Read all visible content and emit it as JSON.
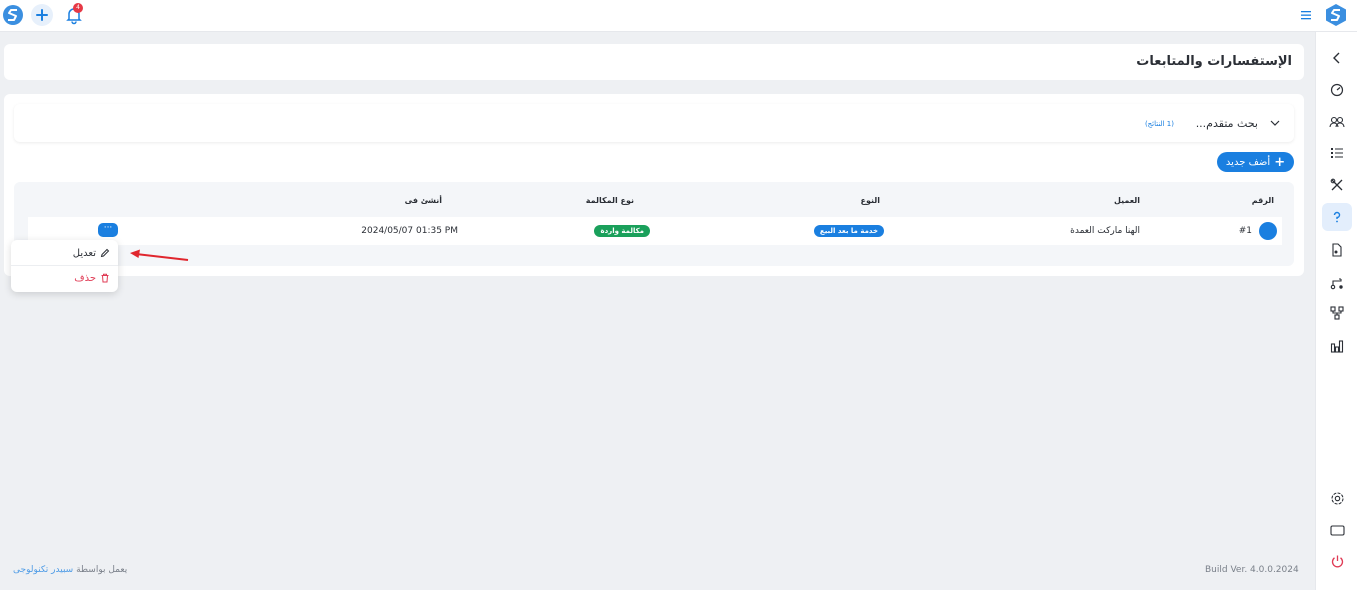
{
  "colors": {
    "accent": "#1a7fe0",
    "success": "#1aa05b",
    "danger": "#e03b55",
    "background": "#eef0f3"
  },
  "topbar": {
    "notification_count": "4",
    "icons": [
      "app-logo-icon",
      "plus-icon",
      "bell-icon",
      "hamburger-menu-icon"
    ]
  },
  "sidebar": {
    "items": [
      {
        "icon": "chevron-left-icon"
      },
      {
        "icon": "dashboard-gauge-icon"
      },
      {
        "icon": "users-icon"
      },
      {
        "icon": "list-icon"
      },
      {
        "icon": "tools-icon"
      },
      {
        "icon": "question-icon",
        "active": true
      },
      {
        "icon": "document-icon"
      },
      {
        "icon": "workflow-icon"
      },
      {
        "icon": "hierarchy-icon"
      },
      {
        "icon": "bar-chart-icon"
      },
      {
        "icon": "settings-icon"
      },
      {
        "icon": "screen-icon"
      },
      {
        "icon": "power-icon"
      }
    ]
  },
  "page": {
    "title": "الإستفسارات والمتابعات"
  },
  "search": {
    "label": "بحث متقدم...",
    "results": "(1 النتائج)"
  },
  "toolbar": {
    "add_label": "أضف جديد"
  },
  "table": {
    "headers": {
      "number": "الرقم",
      "client": "العميل",
      "type": "النوع",
      "call_type": "نوع المكالمة",
      "created_at": "أنشئ فى"
    },
    "rows": [
      {
        "number": "#1",
        "client": "الهنا ماركت العمدة",
        "type": "خدمة ما بعد البيع",
        "call_type": "مكالمة واردة",
        "created_at": "2024/05/07 01:35 PM",
        "actions": "···"
      }
    ]
  },
  "menu": {
    "edit": "تعديل",
    "delete": "حذف"
  },
  "footer": {
    "powered_prefix": "يعمل بواسطة",
    "powered_company": "سبيدر تكنولوجى",
    "build": "Build Ver. 4.0.0.2024"
  }
}
